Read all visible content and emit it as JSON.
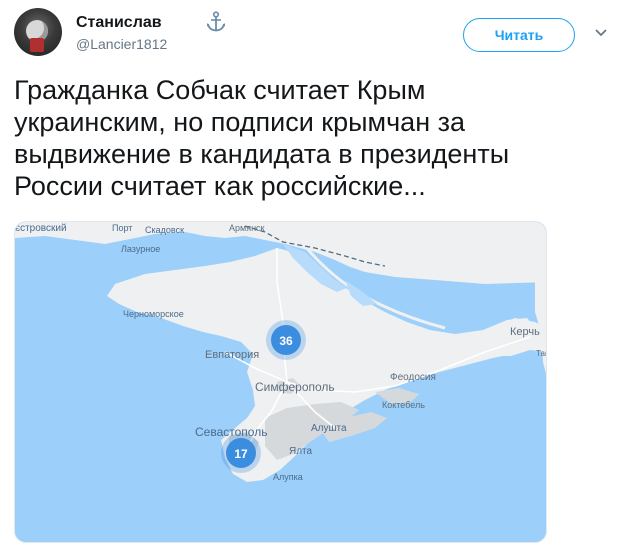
{
  "user": {
    "name": "Станислав",
    "handle": "@Lancier1812",
    "name_icon": "anchor-icon"
  },
  "follow": {
    "label": "Читать"
  },
  "menu": {
    "icon": "chevron-down-icon"
  },
  "tweet": {
    "text": "Гражданка Собчак считает Крым\nукраинским, но подписи крымчан за\nвыдвижение в кандидата в президенты\nРоссии считает как российские..."
  },
  "map": {
    "labels": {
      "skadovsk": "Скадовск",
      "armyansk": "Армянск",
      "port": "Порт",
      "zhovtovsky": "єстровский",
      "lazurnoe": "Лазурное",
      "chernomorskoe": "Черноморское",
      "evpatoria": "Евпатория",
      "simferopol": "Симферополь",
      "feodosia": "Феодосия",
      "koktebel": "Коктебель",
      "kerch": "Керчь",
      "tam": "Там",
      "sevastopol": "Севастополь",
      "alushta": "Алушта",
      "yalta": "Ялта",
      "alupka": "Алупка"
    },
    "clusters": [
      {
        "count": "36"
      },
      {
        "count": "17"
      }
    ],
    "colors": {
      "sea": "#9ccffa",
      "land": "#eef0f2",
      "urban": "#d6d9dc",
      "cluster": "#3b8de0"
    }
  }
}
